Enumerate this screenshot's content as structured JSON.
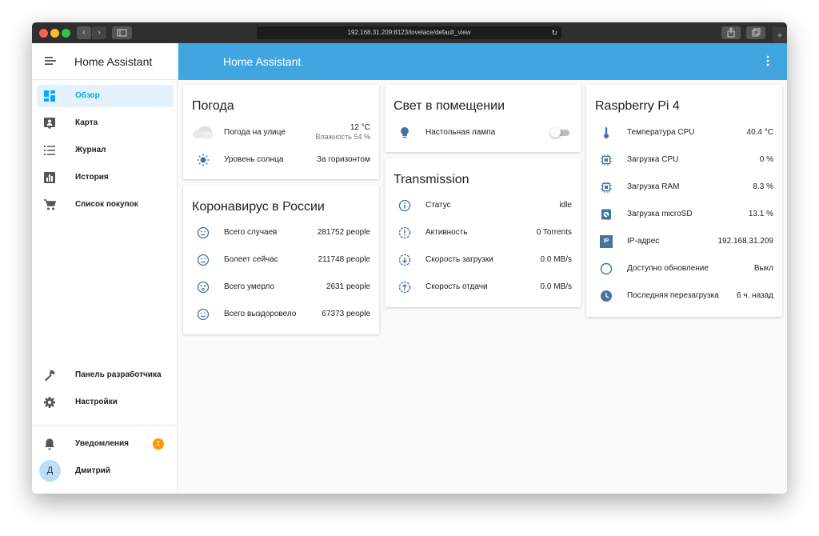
{
  "browser": {
    "url": "192.168.31.209:8123/lovelace/default_view"
  },
  "sidebar": {
    "title": "Home Assistant",
    "items": [
      {
        "label": "Обзор",
        "icon": "dashboard-icon",
        "active": true
      },
      {
        "label": "Карта",
        "icon": "map-account-icon"
      },
      {
        "label": "Журнал",
        "icon": "list-icon"
      },
      {
        "label": "История",
        "icon": "chart-bar-icon"
      },
      {
        "label": "Список покупок",
        "icon": "cart-icon"
      }
    ],
    "bottom_items": [
      {
        "label": "Панель разработчика",
        "icon": "hammer-icon"
      },
      {
        "label": "Настройки",
        "icon": "gear-icon"
      }
    ],
    "notifications": {
      "label": "Уведомления",
      "count": "1",
      "icon": "bell-icon"
    },
    "user": {
      "label": "Дмитрий",
      "initial": "Д"
    }
  },
  "appbar": {
    "title": "Home Assistant",
    "more_icon": "dots-vertical-icon"
  },
  "cards": {
    "weather": {
      "title": "Погода",
      "rows": [
        {
          "name": "Погода на улице",
          "value": "12 °C",
          "secondary": "Влажность 54 %",
          "icon": "cloudy-icon"
        },
        {
          "name": "Уровень солнца",
          "value": "За горизонтом",
          "icon": "sun-icon"
        }
      ]
    },
    "corona": {
      "title": "Коронавирус в России",
      "rows": [
        {
          "name": "Всего случаев",
          "value": "281752 people",
          "icon": "neutral-face-icon"
        },
        {
          "name": "Болеет сейчас",
          "value": "211748 people",
          "icon": "sad-face-icon"
        },
        {
          "name": "Всего умерло",
          "value": "2631 people",
          "icon": "dead-face-icon"
        },
        {
          "name": "Всего выздоровело",
          "value": "67373 people",
          "icon": "happy-face-icon"
        }
      ]
    },
    "light": {
      "title": "Свет в помещении",
      "rows": [
        {
          "name": "Настольная лампа",
          "icon": "lightbulb-icon",
          "state": "off"
        }
      ]
    },
    "transmission": {
      "title": "Transmission",
      "rows": [
        {
          "name": "Статус",
          "value": "idle",
          "icon": "info-icon"
        },
        {
          "name": "Активность",
          "value": "0 Torrents",
          "icon": "alert-circle-icon"
        },
        {
          "name": "Скорость загрузки",
          "value": "0.0 MB/s",
          "icon": "download-icon"
        },
        {
          "name": "Скорость отдачи",
          "value": "0.0 MB/s",
          "icon": "upload-icon"
        }
      ]
    },
    "raspberry": {
      "title": "Raspberry Pi 4",
      "rows": [
        {
          "name": "Температура CPU",
          "value": "40.4 °C",
          "icon": "thermometer-icon"
        },
        {
          "name": "Загрузка CPU",
          "value": "0 %",
          "icon": "chip-icon"
        },
        {
          "name": "Загрузка RAM",
          "value": "8.3 %",
          "icon": "memory-icon"
        },
        {
          "name": "Загрузка microSD",
          "value": "13.1 %",
          "icon": "sd-card-icon"
        },
        {
          "name": "IP-адрес",
          "value": "192.168.31.209",
          "icon": "ip-icon",
          "icon_text": "IP"
        },
        {
          "name": "Доступно обновление",
          "value": "Выкл",
          "icon": "circle-outline-icon"
        },
        {
          "name": "Последняя перезагрузка",
          "value": "6 ч. назад",
          "icon": "clock-icon"
        }
      ]
    }
  },
  "colors": {
    "accent": "#41a6e0",
    "active_label": "#03a9f4",
    "icon": "#44739e",
    "badge": "#ff9800"
  }
}
